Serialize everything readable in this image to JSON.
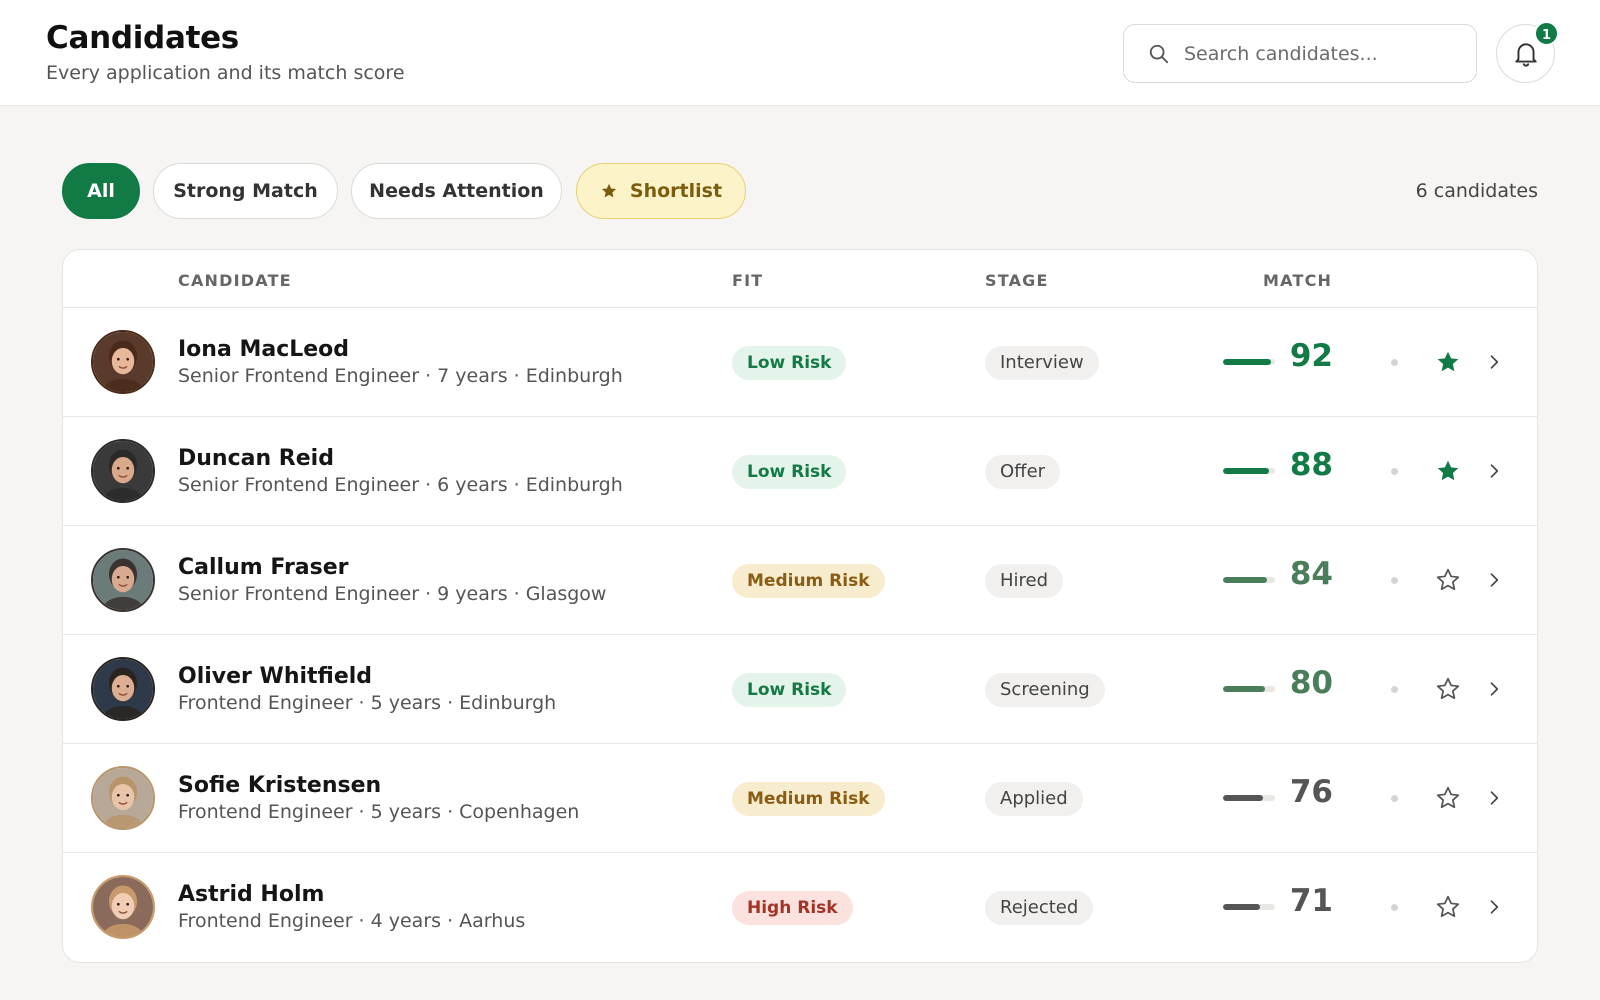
{
  "header": {
    "title": "Candidates",
    "subtitle": "Every application and its match score",
    "search_placeholder": "Search candidates...",
    "notification_count": "1"
  },
  "filters": {
    "chips": [
      "All",
      "Strong Match",
      "Needs Attention",
      "Shortlist"
    ],
    "active": "All",
    "count_label": "6 candidates"
  },
  "table": {
    "columns": [
      "CANDIDATE",
      "FIT",
      "STAGE",
      "MATCH"
    ],
    "rows": [
      {
        "name": "Iona MacLeod",
        "meta": "Senior Frontend Engineer · 7 years · Edinburgh",
        "fit": "Low Risk",
        "fit_level": "low",
        "stage": "Interview",
        "score": "92",
        "score_pct": 92,
        "starred": true
      },
      {
        "name": "Duncan Reid",
        "meta": "Senior Frontend Engineer · 6 years · Edinburgh",
        "fit": "Low Risk",
        "fit_level": "low",
        "stage": "Offer",
        "score": "88",
        "score_pct": 88,
        "starred": true
      },
      {
        "name": "Callum Fraser",
        "meta": "Senior Frontend Engineer · 9 years · Glasgow",
        "fit": "Medium Risk",
        "fit_level": "medium",
        "stage": "Hired",
        "score": "84",
        "score_pct": 84,
        "starred": false
      },
      {
        "name": "Oliver Whitfield",
        "meta": "Frontend Engineer · 5 years · Edinburgh",
        "fit": "Low Risk",
        "fit_level": "low",
        "stage": "Screening",
        "score": "80",
        "score_pct": 80,
        "starred": false
      },
      {
        "name": "Sofie Kristensen",
        "meta": "Frontend Engineer · 5 years · Copenhagen",
        "fit": "Medium Risk",
        "fit_level": "medium",
        "stage": "Applied",
        "score": "76",
        "score_pct": 76,
        "starred": false
      },
      {
        "name": "Astrid Holm",
        "meta": "Frontend Engineer · 4 years · Aarhus",
        "fit": "High Risk",
        "fit_level": "high",
        "stage": "Rejected",
        "score": "71",
        "score_pct": 71,
        "starred": false
      }
    ]
  },
  "colors": {
    "accent": "#117a45",
    "score_strong": "#117a45",
    "score_good": "#4a7d5a",
    "score_neutral": "#555555",
    "star_filled": "#117a45"
  }
}
